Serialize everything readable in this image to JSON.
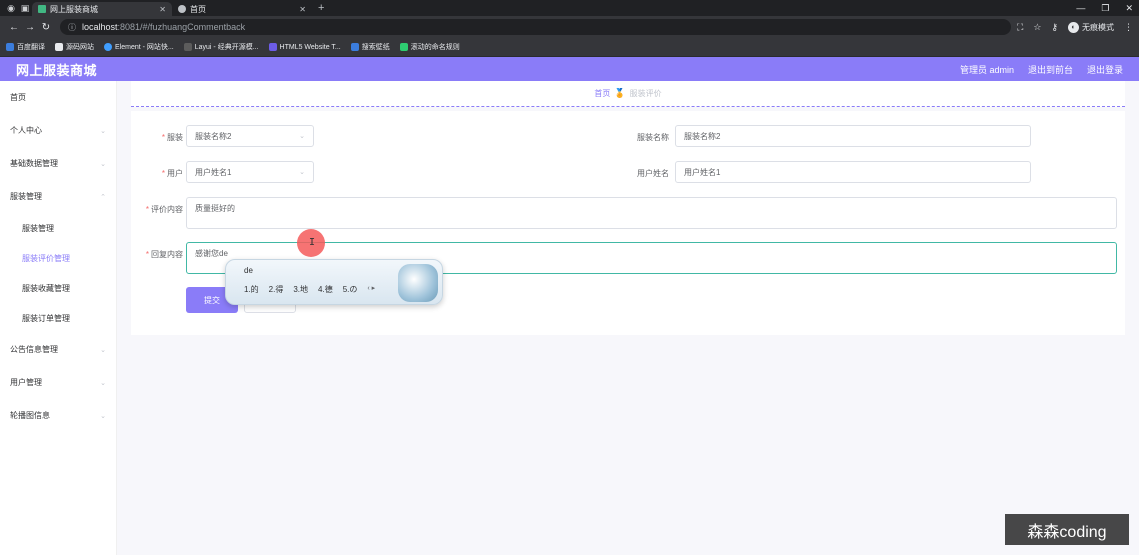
{
  "browser": {
    "tabs": [
      {
        "label": "网上服装商城",
        "active": true
      },
      {
        "label": "首页",
        "active": false
      }
    ],
    "new_tab_glyph": "+",
    "address": {
      "host": "localhost",
      "path": ":8081/#/fuzhuangCommentback"
    },
    "incognito_label": "无痕模式",
    "bookmarks": [
      "百度翻译",
      "源码网站",
      "Element - 网站快...",
      "Layui - 经典开源模...",
      "HTML5 Website T...",
      "搜索壁纸",
      "滚动的命名规则"
    ]
  },
  "header": {
    "logo": "网上服装商城",
    "admin": "管理员 admin",
    "back_link": "退出到前台",
    "logout": "退出登录",
    "accent": "#8a7cf8"
  },
  "sidebar": {
    "items": [
      {
        "label": "首页",
        "has_arrow": false
      },
      {
        "label": "个人中心",
        "has_arrow": true
      },
      {
        "label": "基础数据管理",
        "has_arrow": true
      },
      {
        "label": "服装管理",
        "has_arrow": true,
        "expanded": true
      }
    ],
    "subitems": [
      {
        "label": "服装管理",
        "active": false
      },
      {
        "label": "服装评价管理",
        "active": true
      },
      {
        "label": "服装收藏管理",
        "active": false
      },
      {
        "label": "服装订单管理",
        "active": false
      }
    ],
    "items_after": [
      {
        "label": "公告信息管理"
      },
      {
        "label": "用户管理"
      },
      {
        "label": "轮播图信息"
      }
    ]
  },
  "breadcrumb": {
    "home": "首页",
    "current": "服装评价"
  },
  "form": {
    "fuzhuang_label": "服装",
    "fuzhuang_value": "服装名称2",
    "fuzhuang_name_label": "服装名称",
    "fuzhuang_name_value": "服装名称2",
    "user_label": "用户",
    "user_value": "用户姓名1",
    "user_name_label": "用户姓名",
    "user_name_value": "用户姓名1",
    "comment_label": "评价内容",
    "comment_value": "质量挺好的",
    "reply_label": "回复内容",
    "reply_value": "感谢您de",
    "submit": "提交",
    "required_mark": "*"
  },
  "ime": {
    "composition": "de",
    "candidates": [
      "1.的",
      "2.得",
      "3.地",
      "4.德",
      "5.の"
    ]
  },
  "watermark": "森森coding"
}
